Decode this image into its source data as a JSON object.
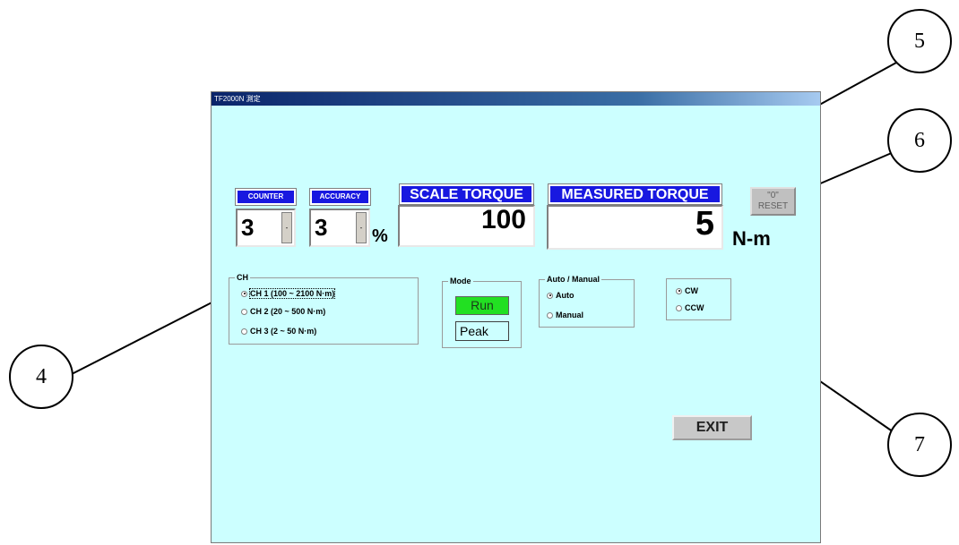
{
  "window": {
    "title": "TF2000N 測定"
  },
  "counter": {
    "label": "COUNTER",
    "value": "3",
    "spin_glyph": "-"
  },
  "accuracy": {
    "label": "ACCURACY",
    "value": "3",
    "spin_glyph": "-",
    "unit": "%"
  },
  "scale_torque": {
    "label": "SCALE TORQUE",
    "value": "100"
  },
  "measured_torque": {
    "label": "MEASURED TORQUE",
    "value": "5",
    "unit": "N-m"
  },
  "reset_button": {
    "label_line1": "\"0\"",
    "label_line2": "RESET"
  },
  "ch_group": {
    "title": "CH",
    "options": [
      {
        "label": "CH 1 (100 ~ 2100 N·m)",
        "selected": true
      },
      {
        "label": "CH 2 (20 ~ 500 N·m)",
        "selected": false
      },
      {
        "label": "CH 3 (2 ~ 50 N·m)",
        "selected": false
      }
    ]
  },
  "mode_group": {
    "title": "Mode",
    "run_label": "Run",
    "peak_label": "Peak"
  },
  "auto_manual_group": {
    "title": "Auto / Manual",
    "options": [
      {
        "label": "Auto",
        "selected": true
      },
      {
        "label": "Manual",
        "selected": false
      }
    ]
  },
  "direction_group": {
    "options": [
      {
        "label": "CW",
        "selected": true
      },
      {
        "label": "CCW",
        "selected": false
      }
    ]
  },
  "exit_button": {
    "label": "EXIT"
  },
  "callouts": [
    "4",
    "5",
    "6",
    "7"
  ],
  "colors": {
    "window_bg": "#ccffff",
    "label_bg": "#1818e0",
    "run_green": "#22e022"
  }
}
